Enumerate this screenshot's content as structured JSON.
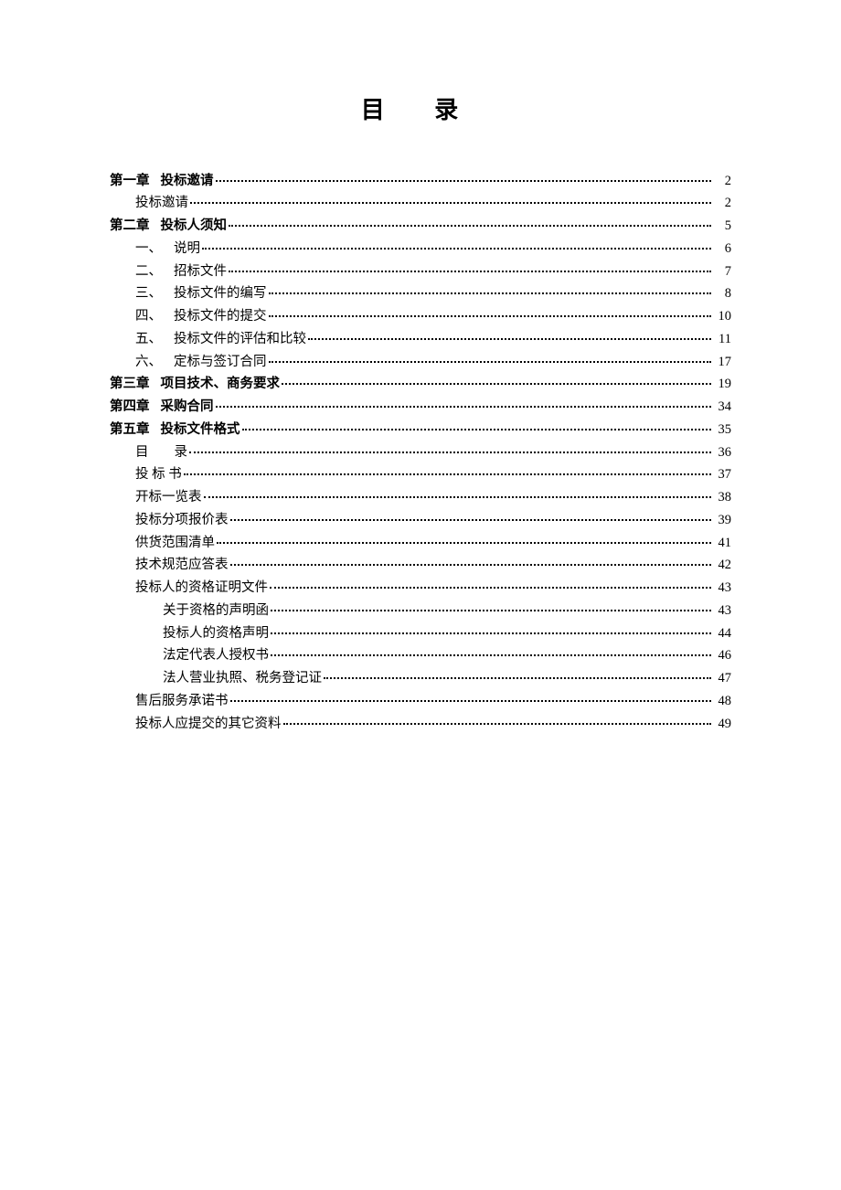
{
  "title": "目 录",
  "toc": [
    {
      "indent": 0,
      "bold": true,
      "prefix": "第一章",
      "label": "投标邀请",
      "page": "2",
      "tight": true
    },
    {
      "indent": 1,
      "bold": false,
      "prefix": "",
      "label": "投标邀请",
      "page": "2"
    },
    {
      "indent": 0,
      "bold": true,
      "prefix": "第二章",
      "label": "投标人须知",
      "page": "5",
      "tight": true
    },
    {
      "indent": 1,
      "bold": false,
      "prefix": "一、",
      "label": "说明",
      "page": "6"
    },
    {
      "indent": 1,
      "bold": false,
      "prefix": "二、",
      "label": "招标文件",
      "page": "7"
    },
    {
      "indent": 1,
      "bold": false,
      "prefix": "三、",
      "label": "投标文件的编写",
      "page": "8"
    },
    {
      "indent": 1,
      "bold": false,
      "prefix": "四、",
      "label": "投标文件的提交",
      "page": "10"
    },
    {
      "indent": 1,
      "bold": false,
      "prefix": "五、",
      "label": "投标文件的评估和比较",
      "page": "11"
    },
    {
      "indent": 1,
      "bold": false,
      "prefix": "六、",
      "label": "定标与签订合同",
      "page": "17"
    },
    {
      "indent": 0,
      "bold": true,
      "prefix": "第三章",
      "label": "项目技术、商务要求",
      "page": "19"
    },
    {
      "indent": 0,
      "bold": true,
      "prefix": "第四章",
      "label": "采购合同",
      "page": "34"
    },
    {
      "indent": 0,
      "bold": true,
      "prefix": "第五章",
      "label": "投标文件格式",
      "page": "35"
    },
    {
      "indent": 1,
      "bold": false,
      "prefix": "",
      "label": "目　　录",
      "page": "36",
      "spaced": true,
      "char1": "目",
      "char2": "录"
    },
    {
      "indent": 1,
      "bold": false,
      "prefix": "",
      "label": "投 标 书",
      "page": "37"
    },
    {
      "indent": 1,
      "bold": false,
      "prefix": "",
      "label": "开标一览表",
      "page": "38"
    },
    {
      "indent": 1,
      "bold": false,
      "prefix": "",
      "label": "投标分项报价表",
      "page": "39"
    },
    {
      "indent": 1,
      "bold": false,
      "prefix": "",
      "label": "供货范围清单",
      "page": "41"
    },
    {
      "indent": 1,
      "bold": false,
      "prefix": "",
      "label": "技术规范应答表",
      "page": "42"
    },
    {
      "indent": 1,
      "bold": false,
      "prefix": "",
      "label": "投标人的资格证明文件",
      "page": "43"
    },
    {
      "indent": 2,
      "bold": false,
      "prefix": "",
      "label": "关于资格的声明函",
      "page": "43",
      "tight": true
    },
    {
      "indent": 2,
      "bold": false,
      "prefix": "",
      "label": "投标人的资格声明",
      "page": "44",
      "tight": true
    },
    {
      "indent": 2,
      "bold": false,
      "prefix": "",
      "label": "法定代表人授权书",
      "page": "46",
      "tight": true
    },
    {
      "indent": 2,
      "bold": false,
      "prefix": "",
      "label": "法人营业执照、税务登记证",
      "page": "47",
      "tight": true
    },
    {
      "indent": 1,
      "bold": false,
      "prefix": "",
      "label": "售后服务承诺书",
      "page": "48"
    },
    {
      "indent": 1,
      "bold": false,
      "prefix": "",
      "label": "投标人应提交的其它资料",
      "page": "49"
    }
  ]
}
